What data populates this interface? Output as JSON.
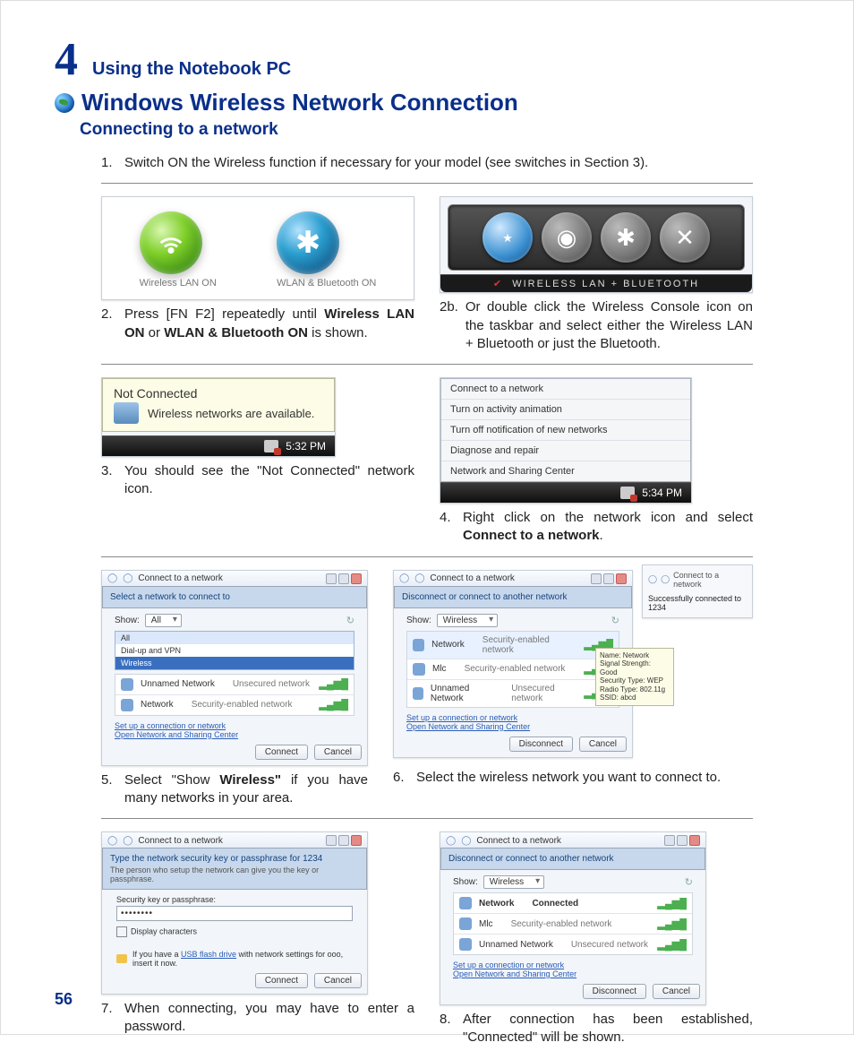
{
  "chapter": {
    "number": "4",
    "title": "Using the Notebook PC"
  },
  "section": "Windows Wireless Network Connection",
  "subsection": "Connecting to a network",
  "page_number": "56",
  "step1": {
    "num": "1.",
    "text": "Switch ON the Wireless function if necessary for your model (see switches in Section 3)."
  },
  "fig1": {
    "cap1": "Wireless LAN ON",
    "cap2": "WLAN & Bluetooth ON"
  },
  "fig_osd": {
    "caption": "WIRELESS LAN + BLUETOOTH"
  },
  "step2": {
    "num": "2.",
    "t1": "Press [FN F2] repeatedly until ",
    "b1": "Wireless LAN ON",
    "t2": " or ",
    "b2": "WLAN & Bluetooth ON",
    "t3": " is shown."
  },
  "step2b": {
    "num": "2b.",
    "text": "Or double click the Wireless Console icon on the taskbar and select either the Wireless LAN + Bluetooth or just the Bluetooth."
  },
  "fig3": {
    "title": "Not Connected",
    "msg": "Wireless networks are available.",
    "time": "5:32 PM"
  },
  "fig4": {
    "m1": "Connect to a network",
    "m2": "Turn on activity animation",
    "m3": "Turn off notification of new networks",
    "m4": "Diagnose and repair",
    "m5": "Network and Sharing Center",
    "time": "5:34 PM"
  },
  "step3": {
    "num": "3.",
    "text": "You should see the \"Not Connected\" network icon."
  },
  "step4": {
    "num": "4.",
    "t1": "Right click on the network icon and select ",
    "b1": "Connect to a network",
    "t2": "."
  },
  "dlg_common": {
    "title": "Connect to a network",
    "select_legend": "Select a network to connect to",
    "disconnect_legend": "Disconnect or connect to another network",
    "show": "Show:",
    "all": "All",
    "wireless": "Wireless",
    "dialup": "Dial-up and VPN",
    "link1": "Set up a connection or network",
    "link2": "Open Network and Sharing Center",
    "connect": "Connect",
    "cancel": "Cancel",
    "disconnect": "Disconnect"
  },
  "networks": {
    "n1": "Network",
    "n2": "Mlc",
    "n3": "Unnamed Network",
    "sec": "Security-enabled network",
    "unsec": "Unsecured network",
    "connected": "Connected"
  },
  "fig6_tip": {
    "name": "Name: Network",
    "sig": "Signal Strength: Good",
    "sec": "Security Type: WEP",
    "radio": "Radio Type: 802.11g",
    "ssid": "SSID: abcd"
  },
  "fig6_side": {
    "title": "Connect to a network",
    "msg": "Successfully connected to 1234"
  },
  "step5": {
    "num": "5.",
    "t1": "Select \"Show ",
    "b1": "Wireless\"",
    "t2": " if you have many networks in your area."
  },
  "step6": {
    "num": "6.",
    "text": "Select the wireless network you want to connect to."
  },
  "fig7": {
    "legend": "Type the network security key or passphrase for 1234",
    "hint": "The person who setup the network can give you the key or passphrase.",
    "label": "Security key or passphrase:",
    "value": "••••••••",
    "chk": "Display characters",
    "usb1": "If you have a ",
    "usb_link": "USB flash drive",
    "usb2": " with network settings for ooo, insert it now."
  },
  "step7": {
    "num": "7.",
    "text": "When connecting, you may have to enter a password."
  },
  "step8": {
    "num": "8.",
    "text": "After connection has been established, \"Connected\" will be shown."
  }
}
